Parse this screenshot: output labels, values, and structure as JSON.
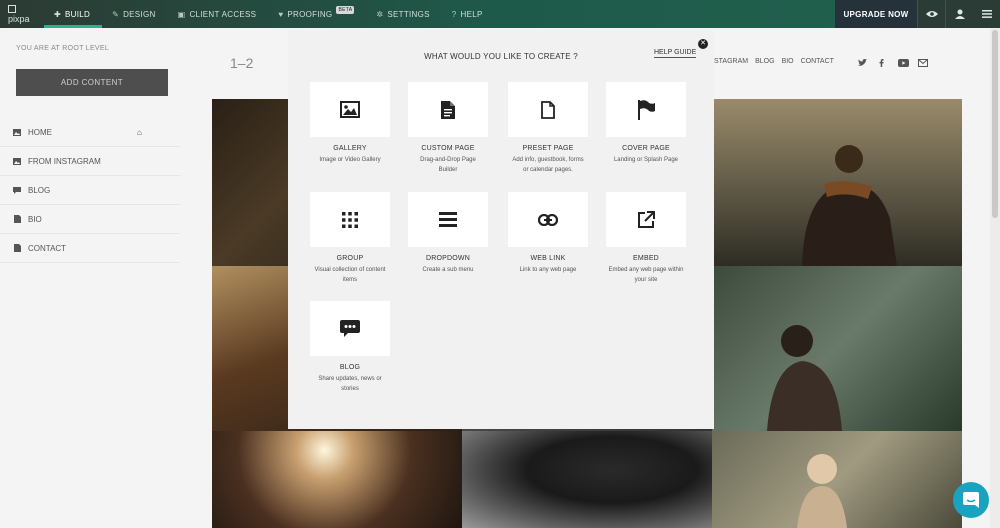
{
  "topbar": {
    "brand": "pixpa",
    "nav": [
      {
        "label": "BUILD",
        "icon": "build-icon",
        "active": true
      },
      {
        "label": "DESIGN",
        "icon": "brush-icon",
        "active": false
      },
      {
        "label": "CLIENT ACCESS",
        "icon": "lock-icon",
        "active": false
      },
      {
        "label": "PROOFING",
        "icon": "heart-icon",
        "active": false,
        "badge": "BETA"
      },
      {
        "label": "SETTINGS",
        "icon": "gear-icon",
        "active": false
      },
      {
        "label": "HELP",
        "icon": "question-icon",
        "active": false
      }
    ],
    "upgrade_label": "UPGRADE NOW",
    "right_icons": [
      "eye-icon",
      "user-icon",
      "menu-icon"
    ]
  },
  "sidebar": {
    "root_label": "YOU ARE AT ROOT LEVEL",
    "add_button": "ADD CONTENT",
    "items": [
      {
        "label": "HOME",
        "icon": "image-icon",
        "home": true
      },
      {
        "label": "FROM INSTAGRAM",
        "icon": "image-icon"
      },
      {
        "label": "BLOG",
        "icon": "comment-icon"
      },
      {
        "label": "BIO",
        "icon": "document-icon"
      },
      {
        "label": "CONTACT",
        "icon": "document-icon"
      }
    ]
  },
  "page": {
    "page_number": "1–2",
    "nav_links": [
      "STAGRAM",
      "BLOG",
      "BIO",
      "CONTACT"
    ],
    "social_icons": [
      "twitter-icon",
      "facebook-icon",
      "youtube-icon",
      "mail-icon"
    ]
  },
  "modal": {
    "title": "WHAT WOULD YOU LIKE TO CREATE ?",
    "help_link": "HELP GUIDE",
    "tiles": [
      {
        "title": "GALLERY",
        "desc": "Image or Video Gallery",
        "icon": "gallery-icon"
      },
      {
        "title": "CUSTOM PAGE",
        "desc": "Drag-and-Drop Page Builder",
        "icon": "custom-page-icon"
      },
      {
        "title": "PRESET PAGE",
        "desc": "Add info, guestbook, forms or calendar pages.",
        "icon": "preset-page-icon"
      },
      {
        "title": "COVER PAGE",
        "desc": "Landing or Splash Page",
        "icon": "flag-icon"
      },
      {
        "title": "GROUP",
        "desc": "Visual collection of content items",
        "icon": "grid-icon"
      },
      {
        "title": "DROPDOWN",
        "desc": "Create a sub menu",
        "icon": "dropdown-icon"
      },
      {
        "title": "WEB LINK",
        "desc": "Link to any web page",
        "icon": "link-icon"
      },
      {
        "title": "EMBED",
        "desc": "Embed any web page within your site",
        "icon": "embed-icon"
      },
      {
        "title": "BLOG",
        "desc": "Share updates, news or stories",
        "icon": "blog-icon"
      }
    ]
  },
  "colors": {
    "accent": "#21b890",
    "topbar": "#1e5a4a",
    "chat": "#1aa3bf"
  }
}
